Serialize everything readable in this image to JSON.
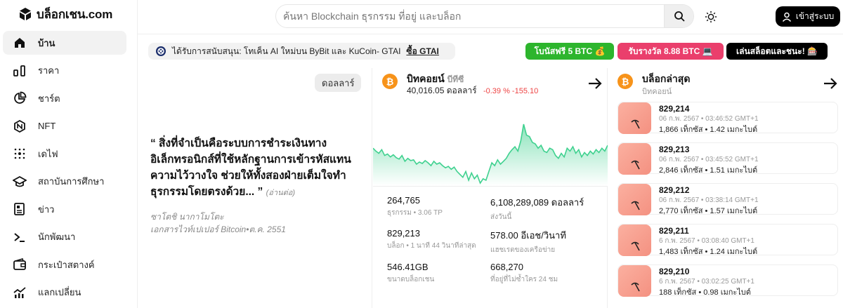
{
  "brand": {
    "name": "บล็อกเชน.com"
  },
  "sidebar": {
    "items": [
      {
        "label": "บ้าน",
        "icon": "home-icon",
        "active": true
      },
      {
        "label": "ราคา",
        "icon": "price-bars-icon"
      },
      {
        "label": "ชาร์ต",
        "icon": "pie-chart-icon"
      },
      {
        "label": "NFT",
        "icon": "nft-hexagon-icon"
      },
      {
        "label": "เดไฟ",
        "icon": "defi-grid-icon"
      },
      {
        "label": "สถาบันการศึกษา",
        "icon": "graduation-cap-icon"
      },
      {
        "label": "ข่าว",
        "icon": "news-icon"
      },
      {
        "label": "นักพัฒนา",
        "icon": "terminal-icon"
      },
      {
        "label": "กระเป๋าสตางค์",
        "icon": "wallet-icon"
      },
      {
        "label": "แลกเปลี่ยน",
        "icon": "exchange-chart-icon"
      }
    ]
  },
  "header": {
    "search_placeholder": "ค้นหา Blockchain ธุรกรรม ที่อยู่ และบล็อก",
    "login_label": "เข้าสู่ระบบ"
  },
  "sponsor": {
    "text": "ได้รับการสนับสนุน: โทเค็น AI ใหม่บน ByBit และ KuCoin- GTAI",
    "link": "ซื้อ GTAI"
  },
  "promos": [
    {
      "label": "โบนัสฟรี 5 BTC 💰",
      "color": "#2db52d"
    },
    {
      "label": "รับรางวัล 8.88 BTC 💻",
      "color": "#ea3f6c"
    },
    {
      "label": "เล่นสล็อตและชนะ! 🎰",
      "color": "#000000"
    }
  ],
  "quote": {
    "currency": "ดอลลาร์",
    "text": "“ สิ่งที่จำเป็นคือระบบการชำระเงินทางอิเล็กทรอนิกส์ที่ใช้หลักฐานการเข้ารหัสแทนความไว้วางใจ ช่วยให้ทั้งสองฝ่ายเต็มใจทำธุรกรรมโดยตรงด้วย... ”",
    "more": "(อ่านต่อ)",
    "author": "ซาโตชิ นากาโมโตะ",
    "source": "เอกสารไวท์เปเปอร์ Bitcoin•ต.ค. 2551"
  },
  "price": {
    "name": "บิทคอยน์",
    "ticker": "บีทีซี",
    "value": "40,016.05 ดอลลาร์",
    "change": "-0.39 %  -155.10",
    "colors": {
      "line": "#3fd18f",
      "fill_top": "#8be3bb",
      "fill_bottom": "#ffffff"
    }
  },
  "chart_data": {
    "type": "area",
    "title": "",
    "series": [
      {
        "values": [
          62,
          58,
          55,
          60,
          52,
          54,
          50,
          53,
          49,
          47,
          52,
          44,
          48,
          45,
          46,
          40,
          43,
          41,
          45,
          42,
          38,
          44,
          40,
          42,
          38,
          35,
          37,
          33,
          36,
          30,
          26,
          22,
          30,
          18,
          28,
          20,
          25,
          14,
          20,
          18,
          30,
          42,
          38,
          46,
          40,
          44,
          48,
          55,
          60,
          64,
          58,
          72,
          95,
          80,
          78,
          70,
          68,
          62,
          66,
          58,
          56,
          62,
          60,
          52,
          48,
          55,
          50,
          62,
          58,
          64,
          55,
          60,
          50,
          56,
          52,
          58,
          54,
          60,
          56,
          62,
          58,
          66
        ]
      }
    ]
  },
  "stats": [
    {
      "value": "264,765",
      "label": "ธุรกรรม • 3.06 TP"
    },
    {
      "value": "6,108,289,089 ดอลลาร์",
      "label": "ส่งวันนี้"
    },
    {
      "value": "829,213",
      "label": "บล็อก • 1 นาที 44 วินาทีล่าสุด"
    },
    {
      "value": "578.00 อีเอช/วินาที",
      "label": "แฮชเรตของเครือข่าย"
    },
    {
      "value": "546.41GB",
      "label": "ขนาดบล็อกเชน"
    },
    {
      "value": "668,270",
      "label": "ที่อยู่ที่ไม่ซ้ำใคร 24 ชม"
    }
  ],
  "blocks": {
    "title": "บล็อกล่าสุด",
    "subtitle": "บิทคอยน์",
    "items": [
      {
        "number": "829,214",
        "time": "06 ก.พ. 2567 • 03:46:52 GMT+1",
        "tx": "1,866 เท็กซัส • 1.42 เมกะไบต์"
      },
      {
        "number": "829,213",
        "time": "06 ก.พ. 2567 • 03:45:52 GMT+1",
        "tx": "2,846 เท็กซัส • 1.51 เมกะไบต์"
      },
      {
        "number": "829,212",
        "time": "06 ก.พ. 2567 • 03:38:14 GMT+1",
        "tx": "2,770 เท็กซัส • 1.57 เมกะไบต์"
      },
      {
        "number": "829,211",
        "time": "6 ก.พ. 2567 • 03:08:40 GMT+1",
        "tx": "1,483 เท็กซัส • 1.24 เมกะไบต์"
      },
      {
        "number": "829,210",
        "time": "6 ก.พ. 2567 • 03:02:25 GMT+1",
        "tx": "188 เท็กซัส • 0.98 เมกะไบต์"
      }
    ]
  }
}
